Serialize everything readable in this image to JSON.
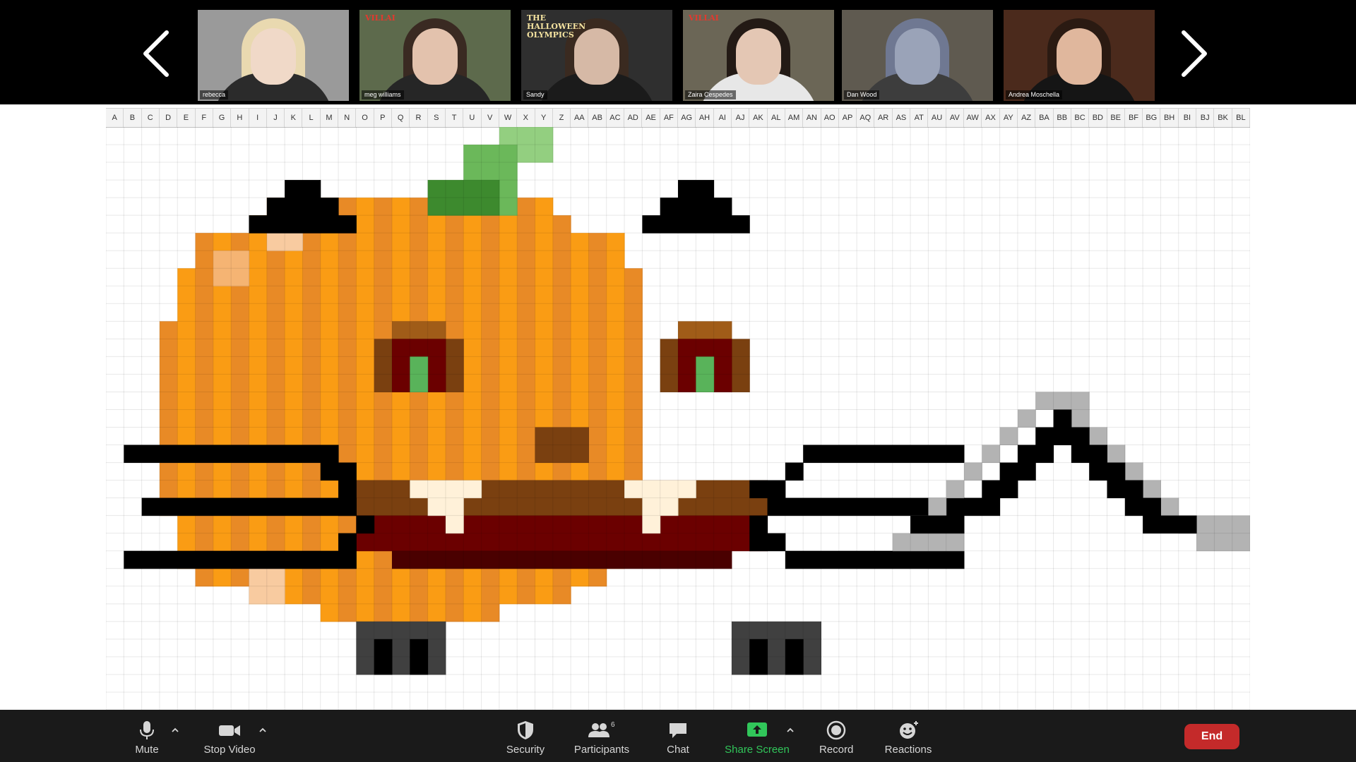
{
  "participants": [
    {
      "name": "rebecca",
      "bg": "#9a9a9a",
      "skin": "#f0d9c8",
      "hair": "#e9d9b0",
      "clothes": "#2b2b2b"
    },
    {
      "name": "meg williams",
      "bg": "#5d6a4c",
      "skin": "#e3c2ad",
      "hair": "#3a2a22",
      "clothes": "#262626",
      "poster": "VILLAI"
    },
    {
      "name": "Sandy",
      "bg": "#2f2f2f",
      "skin": "#d6b9a6",
      "hair": "#3a2a20",
      "clothes": "#1b1b1b",
      "poster": "THE HALLOWEEN OLYMPICS"
    },
    {
      "name": "Zaira Cespedes",
      "bg": "#6b6656",
      "skin": "#e4c7b4",
      "hair": "#231a15",
      "clothes": "#e7e7e7",
      "poster": "VILLAI"
    },
    {
      "name": "Dan Wood",
      "bg": "#5f5a50",
      "skin": "#9aa3b8",
      "hair": "#6f7892",
      "clothes": "#3d3d3d"
    },
    {
      "name": "Andrea Moschella",
      "bg": "#4b2a1c",
      "skin": "#e0b79d",
      "hair": "#2a1a12",
      "clothes": "#151515"
    }
  ],
  "columns": [
    "A",
    "B",
    "C",
    "D",
    "E",
    "F",
    "G",
    "H",
    "I",
    "J",
    "K",
    "L",
    "M",
    "N",
    "O",
    "P",
    "Q",
    "R",
    "S",
    "T",
    "U",
    "V",
    "W",
    "X",
    "Y",
    "Z",
    "AA",
    "AB",
    "AC",
    "AD",
    "AE",
    "AF",
    "AG",
    "AH",
    "AI",
    "AJ",
    "AK",
    "AL",
    "AM",
    "AN",
    "AO",
    "AP",
    "AQ",
    "AR",
    "AS",
    "AT",
    "AU",
    "AV",
    "AW",
    "AX",
    "AY",
    "AZ",
    "BA",
    "BB",
    "BC",
    "BD",
    "BE",
    "BF",
    "BG",
    "BH",
    "BI",
    "BJ",
    "BK",
    "BL"
  ],
  "toolbar": {
    "mute": "Mute",
    "stop_video": "Stop Video",
    "security": "Security",
    "participants": "Participants",
    "participants_count": "6",
    "chat": "Chat",
    "share_screen": "Share Screen",
    "record": "Record",
    "reactions": "Reactions",
    "end": "End"
  },
  "colors": {
    "share_green": "#31c65a",
    "end_red": "#c42a2a",
    "pumpkin_orange": "#fa9c14",
    "pumpkin_stripe": "#e88a26",
    "stem_green": "#3d8a2e",
    "mouth_red": "#6b0000"
  }
}
